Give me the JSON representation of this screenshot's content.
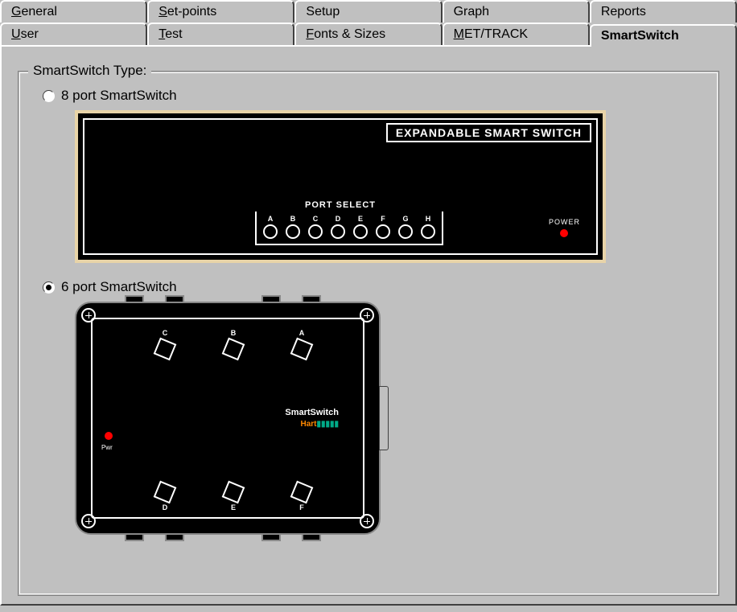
{
  "tabs_row1": [
    {
      "label": "General",
      "u": "G"
    },
    {
      "label": "Set-points",
      "u": "S"
    },
    {
      "label": "Setup",
      "u": ""
    },
    {
      "label": "Graph",
      "u": ""
    },
    {
      "label": "Reports",
      "u": ""
    }
  ],
  "tabs_row2": [
    {
      "label": "User",
      "u": "U"
    },
    {
      "label": "Test",
      "u": "T"
    },
    {
      "label": "Fonts & Sizes",
      "u": "F"
    },
    {
      "label": "MET/TRACK",
      "u": "M"
    },
    {
      "label": "SmartSwitch",
      "u": "",
      "active": true
    }
  ],
  "group_title": "SmartSwitch Type:",
  "options": {
    "opt8": "8 port SmartSwitch",
    "opt6": "6 port SmartSwitch"
  },
  "selected": "6",
  "device8": {
    "title": "EXPANDABLE SMART SWITCH",
    "port_select": "PORT SELECT",
    "ports": [
      "A",
      "B",
      "C",
      "D",
      "E",
      "F",
      "G",
      "H"
    ],
    "power": "POWER"
  },
  "device6": {
    "brand": "SmartSwitch",
    "sub": "Hart",
    "ports_top": [
      "C",
      "B",
      "A"
    ],
    "ports_bottom": [
      "D",
      "E",
      "F"
    ],
    "power": "Pwr"
  }
}
